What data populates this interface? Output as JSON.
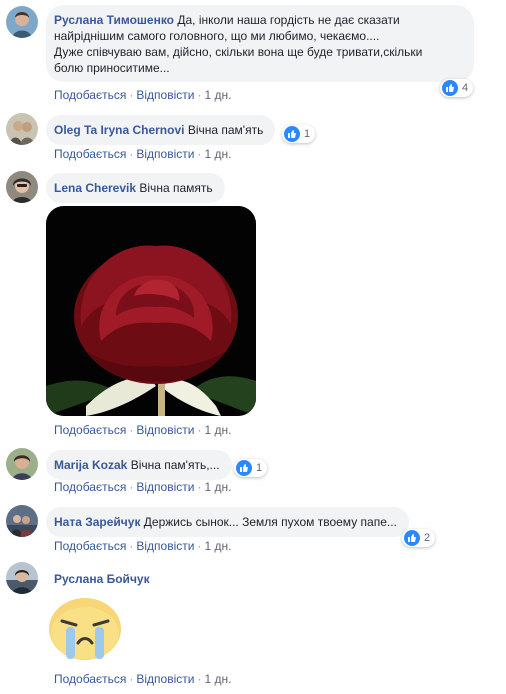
{
  "actions": {
    "like": "Подобається",
    "reply": "Відповісти",
    "sep": "·"
  },
  "comments": [
    {
      "author": "Руслана Тимошенко",
      "line1": "Да, інколи наша гордість не дає сказати",
      "line2": "найріднішим самого головного, що ми любимо, чекаємо....",
      "line3": "Дуже співчуваю вам, дійсно, скільки вона ще буде тривати,скільки",
      "line4": "болю приноситиме...",
      "time": "1 дн.",
      "reactions": "4"
    },
    {
      "author": "Oleg Ta Iryna Chernovi",
      "text": "Вічна пам'ять",
      "time": "1 дн.",
      "reactions": "1"
    },
    {
      "author": "Lena Cherevik",
      "text": "Вічна память",
      "time": "1 дн."
    },
    {
      "author": "Marija Kozak",
      "text": "Вічна пам'ять,...",
      "time": "1 дн.",
      "reactions": "1"
    },
    {
      "author": "Ната Зарейчук",
      "text": "Держись сынок... Земля пухом твоему папе...",
      "time": "1 дн.",
      "reactions": "2"
    },
    {
      "author": "Руслана Бойчук",
      "time": "1 дн."
    }
  ],
  "colors": {
    "author": "#385898",
    "bubble": "#f2f3f5",
    "like": "#2d88ff"
  }
}
